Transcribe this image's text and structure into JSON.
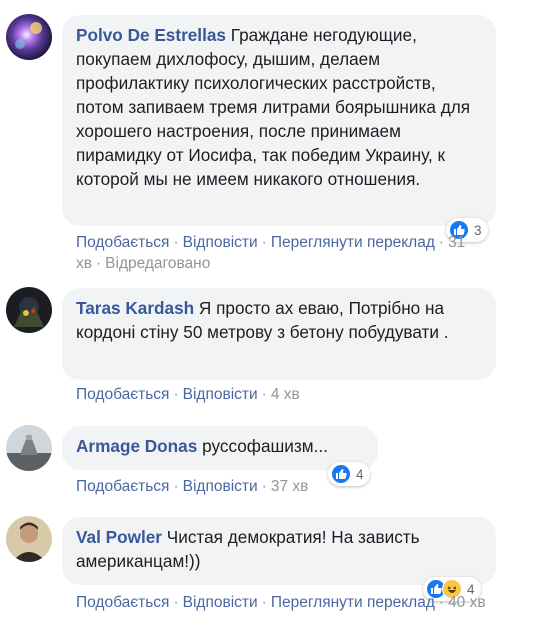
{
  "labels": {
    "like": "Подобається",
    "reply": "Відповісти",
    "see_translation": "Переглянути переклад",
    "edited": "Відредаговано"
  },
  "comments": [
    {
      "author": "Polvo De Estrellas",
      "text": "Граждане негодующие, покупаем дихлофосу, дышим, делаем профилактику психологических расстройств, потом запиваем тремя литрами боярышника для хорошего настроения, после принимаем пирамидку от Иосифа, так победим Украину, к которой мы не имеем никакого отношения.",
      "time": "31 хв",
      "reactions": {
        "icons": [
          "like-icon"
        ],
        "count": "3"
      }
    },
    {
      "author": "Taras Kardash",
      "text": "Я просто ах еваю, Потрібно на кордоні стіну 50 метрову з бетону побудувати .",
      "time": "4 хв"
    },
    {
      "author": "Armage Donas",
      "text": "руссофашизм...",
      "time": "37 хв",
      "reactions": {
        "icons": [
          "like-icon"
        ],
        "count": "4"
      }
    },
    {
      "author": "Val Powler",
      "text": "Чистая демократия! На зависть американцам!))",
      "time": "40 хв",
      "reactions": {
        "icons": [
          "like-icon",
          "haha-icon"
        ],
        "count": "4"
      }
    }
  ],
  "colors": {
    "link": "#385898",
    "action_link": "#4b67a1",
    "bubble": "#f2f3f5",
    "meta": "#90949c",
    "like": "#1877f2"
  }
}
